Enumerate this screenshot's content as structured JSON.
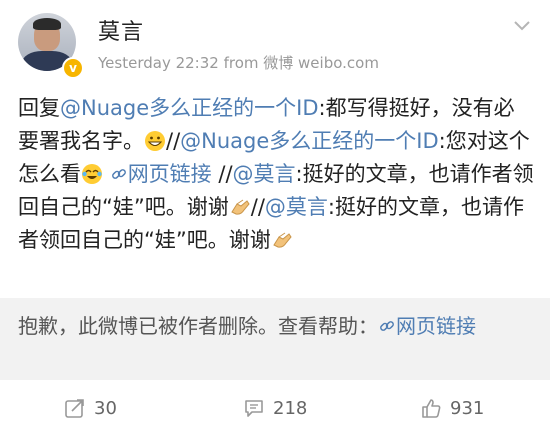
{
  "user": {
    "name": "莫言",
    "verified_badge": "v",
    "meta": "Yesterday 22:32  from 微博 weibo.com"
  },
  "post": {
    "t1": "回复",
    "m1": "@Nuage多么正经的一个ID",
    "t2": ":都写得挺好，没有必要署我名字。",
    "t3": "//",
    "m2": "@Nuage多么正经的一个ID",
    "t4": ":您对这个怎么看",
    "link": "网页链接",
    "t5": " //",
    "m3": "@莫言",
    "t6": ":挺好的文章，也请作者领回自己的“娃”吧。谢谢",
    "t7": "//",
    "m4": "@莫言",
    "t8": ":挺好的文章，也请作者领回自己的“娃”吧。谢谢"
  },
  "deleted_notice": {
    "text": "抱歉，此微博已被作者删除。查看帮助：",
    "link": "网页链接"
  },
  "actions": {
    "repost_count": "30",
    "comment_count": "218",
    "like_count": "931"
  },
  "icons": {
    "header_menu": "chevron-down-icon",
    "repost": "repost-icon",
    "comment": "comment-icon",
    "like": "thumbs-up-icon"
  },
  "colors": {
    "link": "#4f7db3",
    "badge": "#f7b500",
    "deleted_bg": "#f2f2f2"
  }
}
